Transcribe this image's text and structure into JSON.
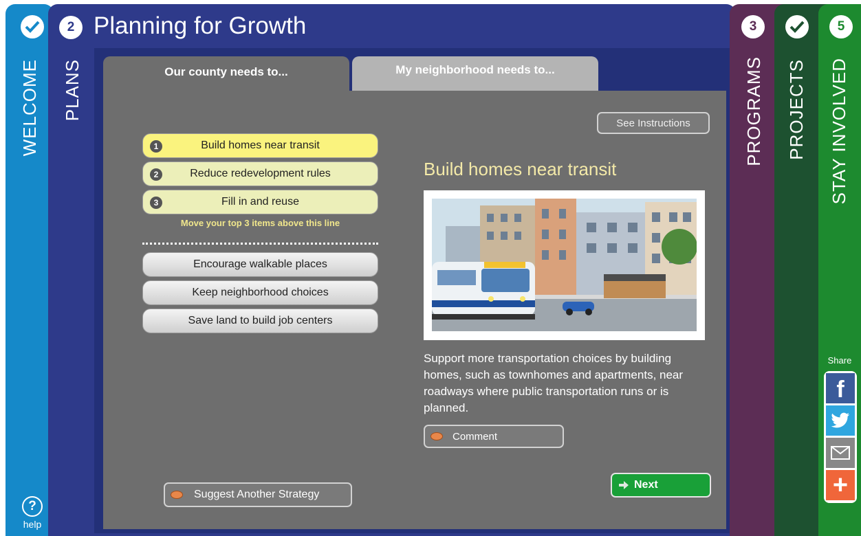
{
  "welcome": {
    "label": "WELCOME",
    "status_icon": "check-icon"
  },
  "help": {
    "glyph": "?",
    "label": "help"
  },
  "plans": {
    "number": "2",
    "label": "PLANS",
    "title": "Planning for Growth"
  },
  "tabs": [
    {
      "label": "Our county needs to..."
    },
    {
      "label": "My neighborhood needs to..."
    }
  ],
  "instructions_button": "See Instructions",
  "ranked_items": [
    {
      "rank": "1",
      "label": "Build homes near transit"
    },
    {
      "rank": "2",
      "label": "Reduce redevelopment rules"
    },
    {
      "rank": "3",
      "label": "Fill in and reuse"
    }
  ],
  "move_hint": "Move your top 3 items above this line",
  "other_items": [
    {
      "label": "Encourage walkable places"
    },
    {
      "label": "Keep neighborhood choices"
    },
    {
      "label": "Save land to build job centers"
    }
  ],
  "detail": {
    "title": "Build homes near transit",
    "description": "Support more transportation choices by building homes, such as townhomes and apartments, near roadways where public transportation runs or is planned.",
    "photo_icon": "light-rail-photo"
  },
  "comment_button": "Comment",
  "next_button": "Next",
  "suggest_button": "Suggest Another Strategy",
  "programs": {
    "number": "3",
    "label": "PROGRAMS"
  },
  "projects": {
    "label": "PROJECTS",
    "status_icon": "check-icon"
  },
  "stay_involved": {
    "number": "5",
    "label": "STAY INVOLVED"
  },
  "share": {
    "label": "Share",
    "facebook_glyph": "f",
    "add_glyph": "+",
    "buttons": [
      "facebook-icon",
      "twitter-icon",
      "email-icon",
      "add-icon"
    ]
  },
  "colors": {
    "welcome": "#1589c9",
    "plans": "#2e3a8a",
    "programs": "#5c2d55",
    "projects": "#1d5130",
    "stay_involved": "#1d8a2f",
    "rank_highlight": "#faf37e",
    "next": "#19a038"
  }
}
